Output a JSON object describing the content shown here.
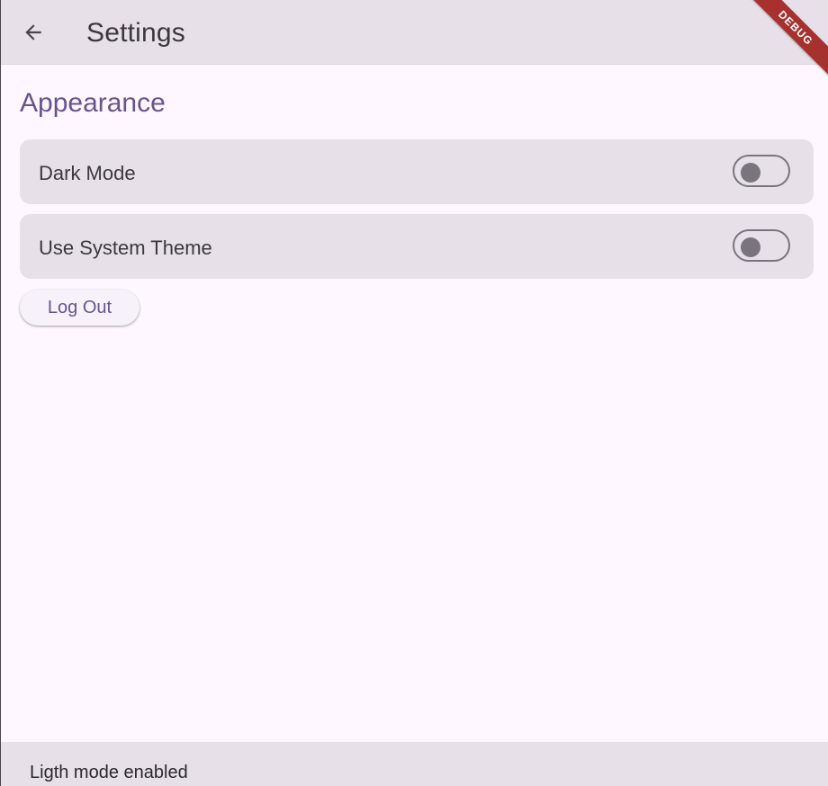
{
  "appbar": {
    "title": "Settings",
    "back_icon": "arrow-back-icon",
    "debug_banner": "DEBUG"
  },
  "section": {
    "title": "Appearance"
  },
  "settings": [
    {
      "label": "Dark Mode",
      "enabled": false
    },
    {
      "label": "Use System Theme",
      "enabled": false
    }
  ],
  "logout": {
    "label": "Log Out"
  },
  "snackbar": {
    "message": "Ligth mode enabled"
  },
  "colors": {
    "accent": "#65558f",
    "surface": "#e7e0e8",
    "background": "#fef7ff",
    "debug_banner": "#a6312f"
  }
}
